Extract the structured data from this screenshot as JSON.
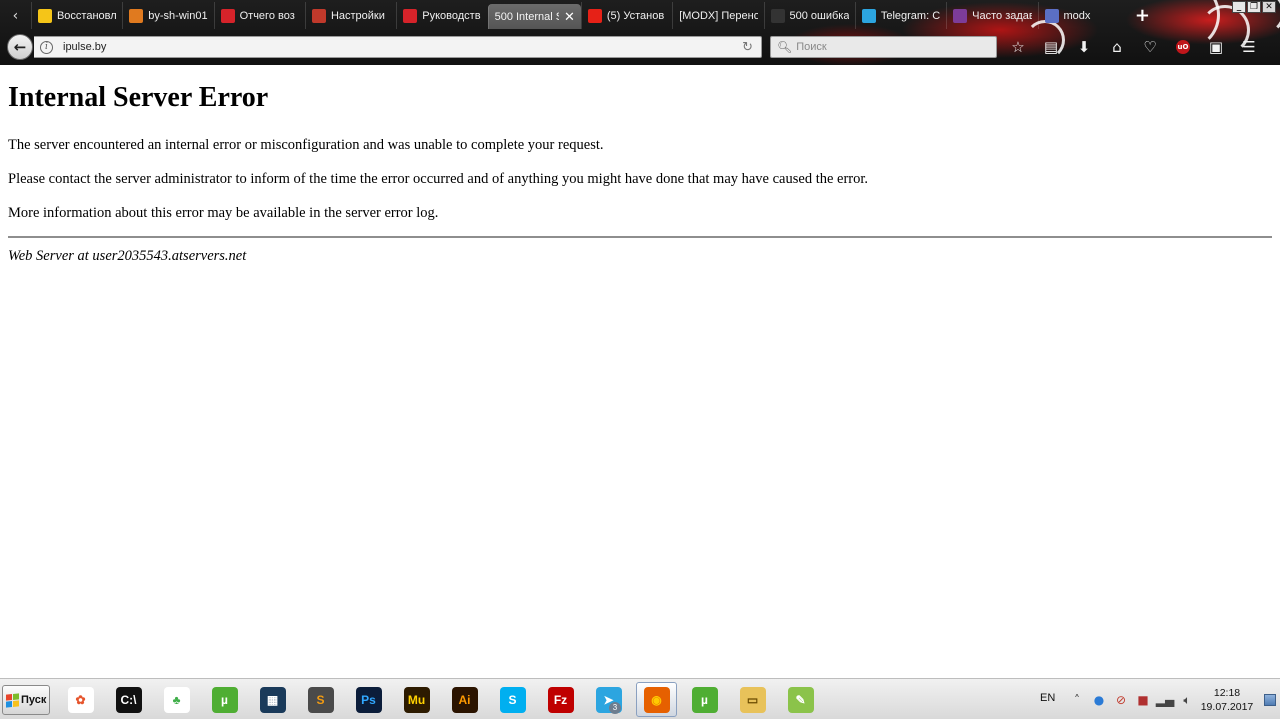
{
  "browser": {
    "tabs": [
      {
        "label": "Восстановл",
        "icon": "warning-icon",
        "color": "#f5c518"
      },
      {
        "label": "by-sh-win01",
        "icon": "app-logo-icon",
        "color": "#e07a1f"
      },
      {
        "label": "Отчего воз",
        "icon": "letter-d-icon",
        "color": "#d6232a"
      },
      {
        "label": "Настройки",
        "icon": "settings-favicon-icon",
        "color": "#c0392b"
      },
      {
        "label": "Руководств",
        "icon": "bars-favicon-icon",
        "color": "#d6232a"
      },
      {
        "label": "500 Internal S",
        "icon": "none",
        "color": "#555555",
        "active": true
      },
      {
        "label": "(5) Установ",
        "icon": "youtube-icon",
        "color": "#e62117"
      },
      {
        "label": "[MODX] Перенос",
        "icon": "none",
        "color": "#555555"
      },
      {
        "label": "500 ошибка",
        "icon": "github-icon",
        "color": "#333333"
      },
      {
        "label": "Telegram: C",
        "icon": "telegram-icon",
        "color": "#2ca5e0"
      },
      {
        "label": "Часто задав",
        "icon": "ua-favicon-icon",
        "color": "#7d3c98"
      },
      {
        "label": "modx",
        "icon": "modx-favicon-icon",
        "color": "#5b6fc4"
      }
    ],
    "active_tab_close_glyph": "✕",
    "new_tab_glyph": "+",
    "url": "ipulse.by",
    "search_placeholder": "Поиск",
    "window_controls": [
      "_",
      "❐",
      "✕"
    ]
  },
  "page": {
    "title": "Internal Server Error",
    "paragraphs": [
      "The server encountered an internal error or misconfiguration and was unable to complete your request.",
      "Please contact the server administrator to inform of the time the error occurred and of anything you might have done that may have caused the error.",
      "More information about this error may be available in the server error log."
    ],
    "signature": "Web Server at user2035543.atservers.net"
  },
  "taskbar": {
    "start_label": "Пуск",
    "apps": [
      {
        "name": "picasa-icon",
        "glyph": "✿",
        "bg": "#ffffff",
        "fg": "#e6552d"
      },
      {
        "name": "command-prompt-icon",
        "glyph": "C:\\",
        "bg": "#111111",
        "fg": "#ffffff"
      },
      {
        "name": "clover-icon",
        "glyph": "♣",
        "bg": "#ffffff",
        "fg": "#3fae49"
      },
      {
        "name": "utorrent-icon",
        "glyph": "µ",
        "bg": "#4fae33",
        "fg": "#ffffff"
      },
      {
        "name": "film-editor-icon",
        "glyph": "▦",
        "bg": "#1a3a5a",
        "fg": "#ffffff"
      },
      {
        "name": "sublime-text-icon",
        "glyph": "S",
        "bg": "#4a4a4a",
        "fg": "#f39c12"
      },
      {
        "name": "photoshop-icon",
        "glyph": "Ps",
        "bg": "#0b1d3a",
        "fg": "#31a8ff"
      },
      {
        "name": "muse-icon",
        "glyph": "Mu",
        "bg": "#2d1b00",
        "fg": "#ffd200"
      },
      {
        "name": "illustrator-icon",
        "glyph": "Ai",
        "bg": "#2b1400",
        "fg": "#ff9a00"
      },
      {
        "name": "skype-icon",
        "glyph": "S",
        "bg": "#00aff0",
        "fg": "#ffffff"
      },
      {
        "name": "filezilla-icon",
        "glyph": "Fz",
        "bg": "#bf0000",
        "fg": "#ffffff"
      },
      {
        "name": "telegram-app-icon",
        "glyph": "➤",
        "bg": "#2ca5e0",
        "fg": "#ffffff",
        "badge": "3"
      },
      {
        "name": "firefox-icon",
        "glyph": "◉",
        "bg": "#e66000",
        "fg": "#ffcb00",
        "active": true
      },
      {
        "name": "utorrent-2-icon",
        "glyph": "µ",
        "bg": "#4fae33",
        "fg": "#ffffff"
      },
      {
        "name": "file-explorer-icon",
        "glyph": "▭",
        "bg": "#e8c25a",
        "fg": "#6a4b00"
      },
      {
        "name": "notepad-plus-icon",
        "glyph": "✎",
        "bg": "#8bc34a",
        "fg": "#ffffff"
      }
    ],
    "language": "EN",
    "clock_time": "12:18",
    "clock_date": "19.07.2017"
  },
  "colors": {
    "chrome_dark": "#111111",
    "chrome_accent": "#c8141414",
    "divider": "#8e8e8e"
  }
}
